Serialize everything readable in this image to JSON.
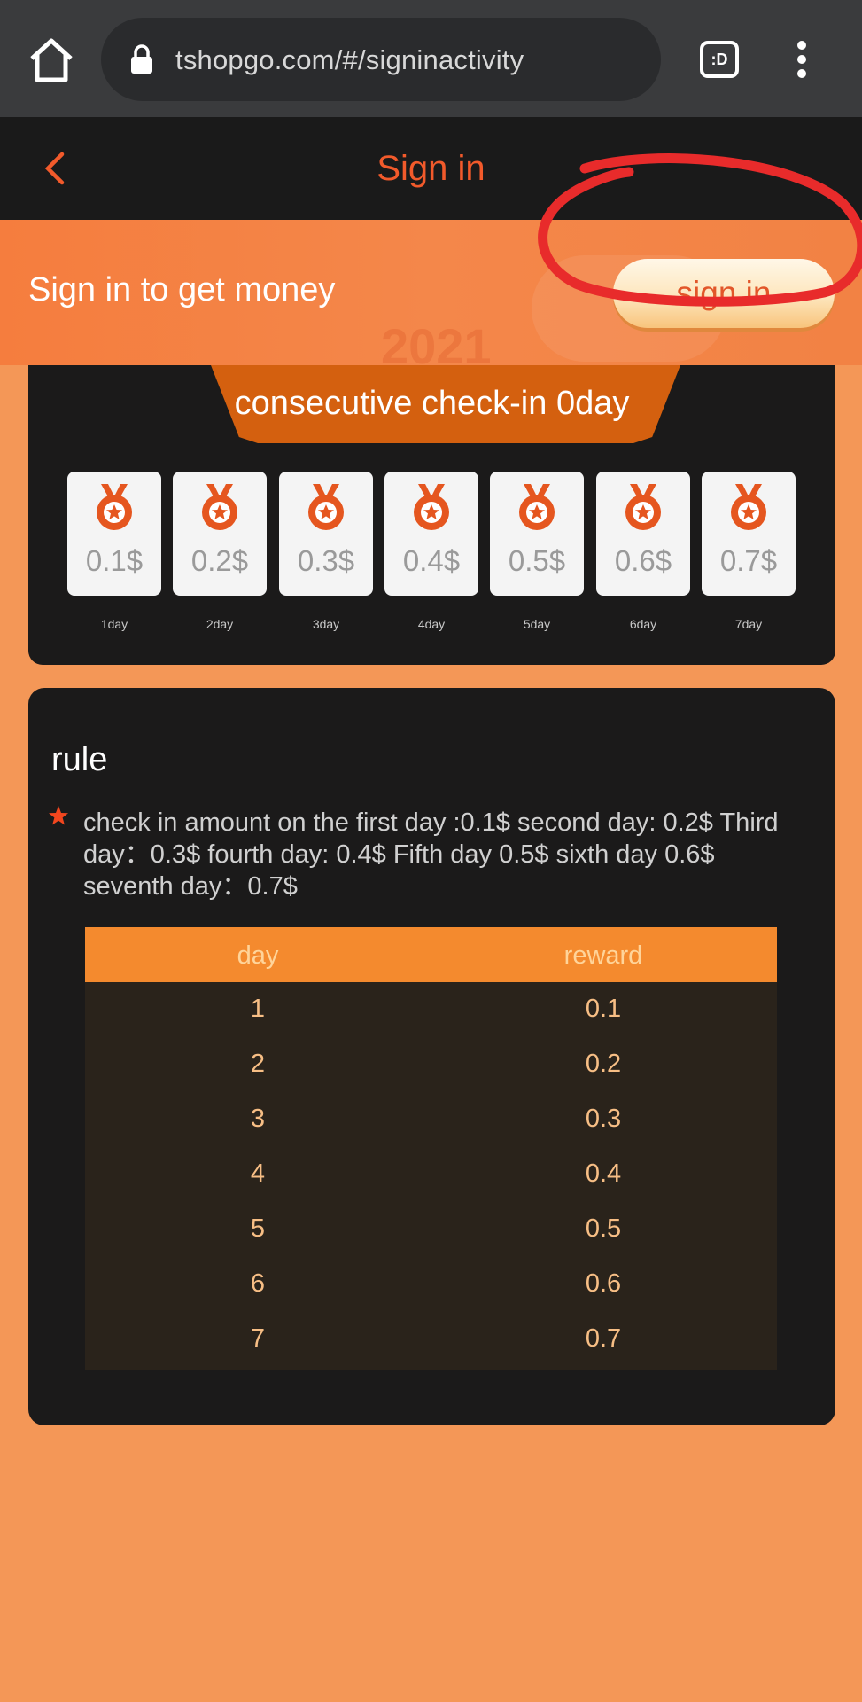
{
  "browser": {
    "url": "tshopgo.com/#/signinactivity",
    "tab_label": ":D"
  },
  "header": {
    "title": "Sign in"
  },
  "banner": {
    "text": "Sign in to get money",
    "button_label": "sign in",
    "year_deco": "2021"
  },
  "checkin": {
    "streak_text": "consecutive check-in 0day",
    "days": [
      {
        "amount": "0.1$",
        "label": "1day"
      },
      {
        "amount": "0.2$",
        "label": "2day"
      },
      {
        "amount": "0.3$",
        "label": "3day"
      },
      {
        "amount": "0.4$",
        "label": "4day"
      },
      {
        "amount": "0.5$",
        "label": "5day"
      },
      {
        "amount": "0.6$",
        "label": "6day"
      },
      {
        "amount": "0.7$",
        "label": "7day"
      }
    ]
  },
  "rule": {
    "title": "rule",
    "text": "check in amount on the first day :0.1$ second day: 0.2$ Third day：0.3$ fourth day: 0.4$ Fifth day 0.5$ sixth day 0.6$ seventh day：0.7$",
    "table": {
      "headers": [
        "day",
        "reward"
      ],
      "rows": [
        [
          "1",
          "0.1"
        ],
        [
          "2",
          "0.2"
        ],
        [
          "3",
          "0.3"
        ],
        [
          "4",
          "0.4"
        ],
        [
          "5",
          "0.5"
        ],
        [
          "6",
          "0.6"
        ],
        [
          "7",
          "0.7"
        ]
      ]
    }
  },
  "colors": {
    "page_bg": "#f49757",
    "accent": "#f25a2b",
    "card_bg": "#1b1a1a",
    "table_header": "#f48a2e"
  }
}
